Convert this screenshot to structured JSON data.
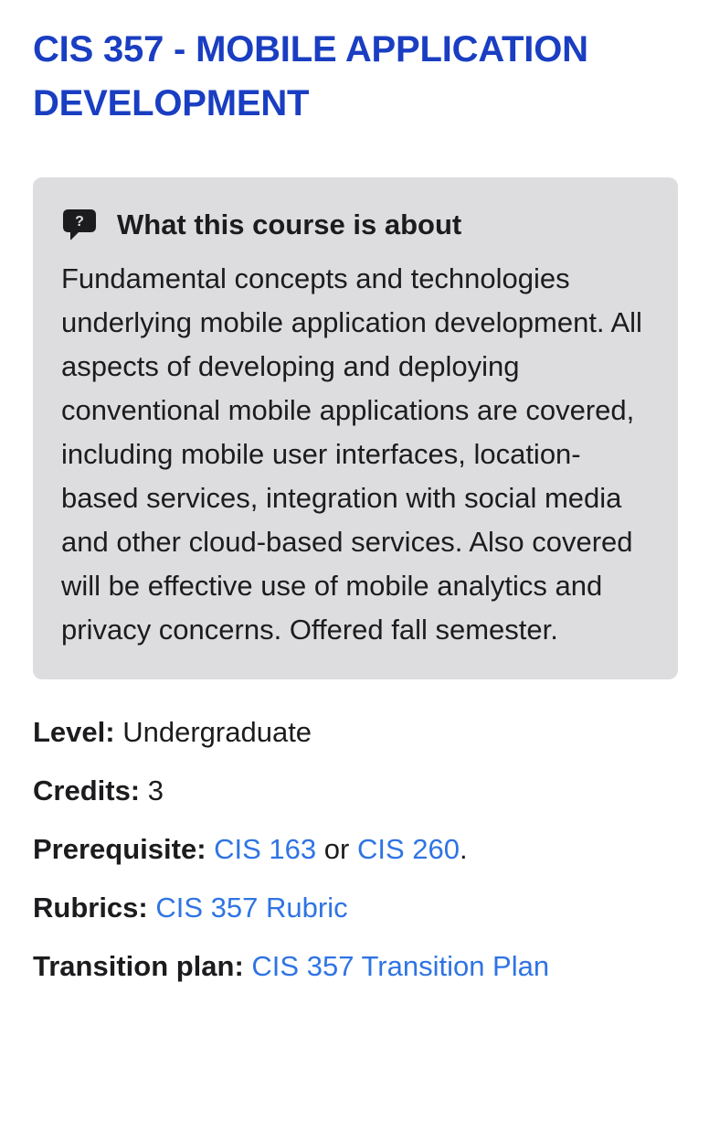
{
  "course": {
    "title": "CIS 357 - MOBILE APPLICATION DEVELOPMENT"
  },
  "about": {
    "icon": "question-bubble-icon",
    "heading": "What this course is about",
    "description": "Fundamental concepts and technologies underlying mobile application development. All aspects of developing and deploying conventional mobile applications are covered, including mobile user interfaces, location-based services, integration with social media and other cloud-based services. Also covered will be effective use of mobile analytics and privacy concerns. Offered fall semester."
  },
  "details": {
    "level": {
      "label": "Level:",
      "value": "Undergraduate"
    },
    "credits": {
      "label": "Credits:",
      "value": "3"
    },
    "prerequisite": {
      "label": "Prerequisite:",
      "link1": "CIS 163",
      "connector": "or",
      "link2": "CIS 260",
      "suffix": "."
    },
    "rubrics": {
      "label": "Rubrics:",
      "link": "CIS 357 Rubric"
    },
    "transition_plan": {
      "label": "Transition plan:",
      "link": "CIS 357 Transition Plan"
    }
  },
  "colors": {
    "title": "#1a3ec2",
    "link": "#2f74e3",
    "box_background": "#dddde0",
    "text": "#1c1c1e"
  }
}
